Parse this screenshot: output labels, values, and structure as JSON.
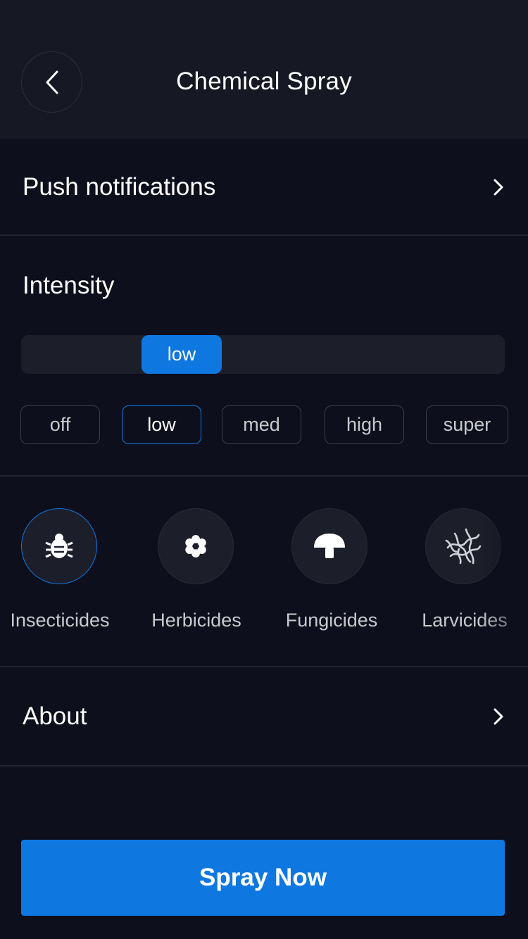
{
  "header": {
    "title": "Chemical Spray"
  },
  "notifications": {
    "label": "Push notifications"
  },
  "intensity": {
    "label": "Intensity",
    "current": "low",
    "options": [
      "off",
      "low",
      "med",
      "high",
      "super"
    ]
  },
  "categories": [
    {
      "label": "Insecticides",
      "icon": "bug-icon",
      "active": true
    },
    {
      "label": "Herbicides",
      "icon": "flower-icon",
      "active": false
    },
    {
      "label": "Fungicides",
      "icon": "mushroom-icon",
      "active": false
    },
    {
      "label": "Larvicides",
      "icon": "larva-icon",
      "active": false
    }
  ],
  "about": {
    "label": "About"
  },
  "action": {
    "label": "Spray Now"
  },
  "colors": {
    "accent": "#0f78e0",
    "background": "#0e0f1c",
    "header": "#161824"
  }
}
